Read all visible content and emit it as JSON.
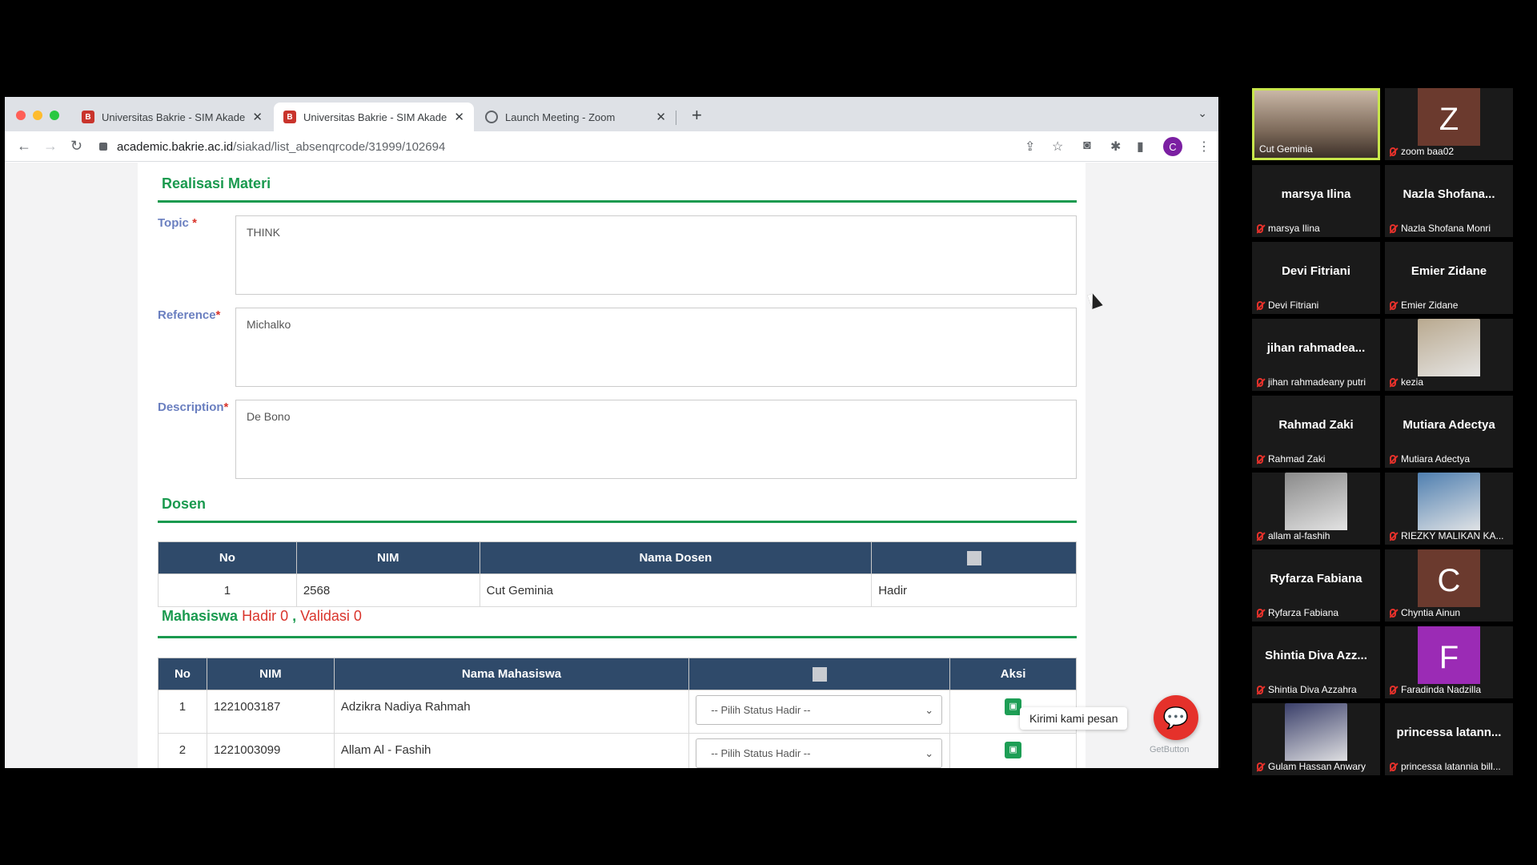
{
  "browser": {
    "tabs": [
      {
        "title": "Universitas Bakrie - SIM Akade",
        "favicon": "bakrie-logo",
        "active": false
      },
      {
        "title": "Universitas Bakrie - SIM Akade",
        "favicon": "bakrie-logo",
        "active": true
      },
      {
        "title": "Launch Meeting - Zoom",
        "favicon": "globe-icon",
        "active": false
      }
    ],
    "url_host": "academic.bakrie.ac.id",
    "url_path": "/siakad/list_absenqrcode/31999/102694",
    "profile_initial": "C"
  },
  "realisasi": {
    "title": "Realisasi Materi",
    "topic_label": "Topic",
    "topic_value": "THINK",
    "reference_label": "Reference",
    "reference_value": "Michalko",
    "description_label": "Description",
    "description_value": "De Bono",
    "required_mark": "*"
  },
  "dosen": {
    "title": "Dosen",
    "columns": [
      "No",
      "NIM",
      "Nama Dosen"
    ],
    "rows": [
      {
        "no": "1",
        "nim": "2568",
        "nama": "Cut Geminia",
        "status": "Hadir"
      }
    ]
  },
  "mahasiswa": {
    "title": "Mahasiswa",
    "hadir_label": "Hadir",
    "hadir_count": "0",
    "separator": ",",
    "validasi_label": "Validasi",
    "validasi_count": "0",
    "columns": [
      "No",
      "NIM",
      "Nama Mahasiswa",
      "Aksi"
    ],
    "select_placeholder": "-- Pilih Status Hadir --",
    "rows": [
      {
        "no": "1",
        "nim": "1221003187",
        "nama": "Adzikra Nadiya Rahmah"
      },
      {
        "no": "2",
        "nim": "1221003099",
        "nama": "Allam Al - Fashih"
      }
    ]
  },
  "chat_widget": {
    "tooltip": "Kirimi kami pesan",
    "brand": "GetButton"
  },
  "zoom": {
    "participants": [
      {
        "big": "",
        "caption": "Cut Geminia",
        "kind": "video",
        "active": true
      },
      {
        "big": "Z",
        "caption": "zoom baa02",
        "kind": "letter",
        "color": "#6b3a2e"
      },
      {
        "big": "marsya Ilina",
        "caption": "marsya Ilina",
        "kind": "name"
      },
      {
        "big": "Nazla  Shofana...",
        "caption": "Nazla Shofana Monri",
        "kind": "name"
      },
      {
        "big": "Devi Fitriani",
        "caption": "Devi Fitriani",
        "kind": "name"
      },
      {
        "big": "Emier Zidane",
        "caption": "Emier Zidane",
        "kind": "name"
      },
      {
        "big": "jihan  rahmadea...",
        "caption": "jihan rahmadeany putri",
        "kind": "name"
      },
      {
        "big": "",
        "caption": "kezia",
        "kind": "photo",
        "color": "#b9a98f"
      },
      {
        "big": "Rahmad Zaki",
        "caption": "Rahmad Zaki",
        "kind": "name"
      },
      {
        "big": "Mutiara Adectya",
        "caption": "Mutiara Adectya",
        "kind": "name"
      },
      {
        "big": "",
        "caption": "allam al-fashih",
        "kind": "photo",
        "color": "#8a8a8a"
      },
      {
        "big": "",
        "caption": "RIEZKY MALIKAN KA...",
        "kind": "photo",
        "color": "#4f7fb0"
      },
      {
        "big": "Ryfarza Fabiana",
        "caption": "Ryfarza Fabiana",
        "kind": "name"
      },
      {
        "big": "C",
        "caption": "Chyntia Ainun",
        "kind": "letter",
        "color": "#6b3a2e"
      },
      {
        "big": "Shintia  Diva  Azz...",
        "caption": "Shintia Diva Azzahra",
        "kind": "name"
      },
      {
        "big": "F",
        "caption": "Faradinda Nadzilla",
        "kind": "letter",
        "color": "#9b2bb5"
      },
      {
        "big": "",
        "caption": "Gulam Hassan Anwary",
        "kind": "photo",
        "color": "#3a3f6a"
      },
      {
        "big": "princessa  latann...",
        "caption": "princessa latannia bill...",
        "kind": "name"
      }
    ]
  }
}
